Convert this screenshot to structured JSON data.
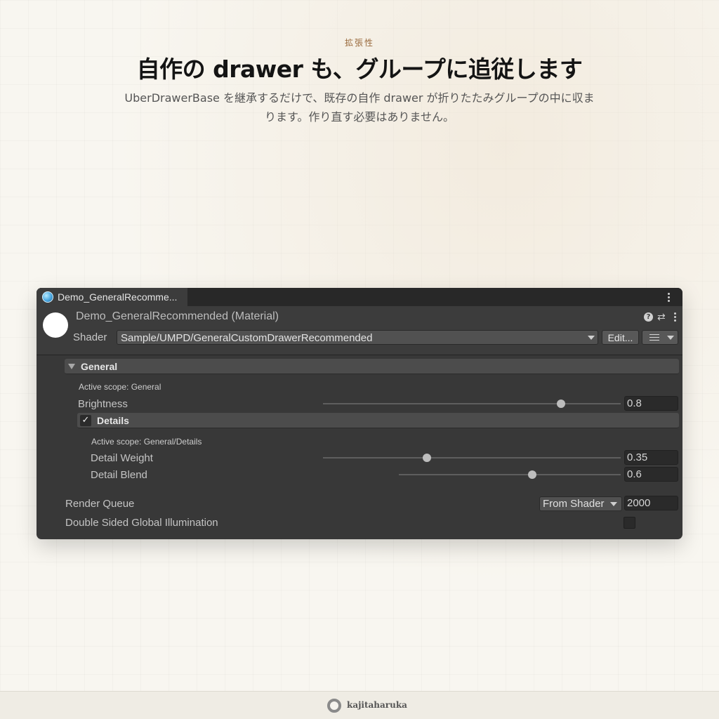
{
  "page": {
    "eyebrow": "拡張性",
    "headline": "自作の drawer も、グループに追従します",
    "subtext": "UberDrawerBase を継承するだけで、既存の自作 drawer が折りたたみグループの中に収まります。作り直す必要はありません。"
  },
  "inspector": {
    "tab_label": "Demo_GeneralRecomme...",
    "material_title": "Demo_GeneralRecommended (Material)",
    "shader_label": "Shader",
    "shader_value": "Sample/UMPD/GeneralCustomDrawerRecommended",
    "edit_label": "Edit...",
    "help_glyph": "?",
    "preset_glyph": "⇄",
    "groups": {
      "general": {
        "label": "General",
        "scope": "Active scope: General",
        "brightness_label": "Brightness",
        "brightness_value": "0.8",
        "brightness_fraction": 0.8
      },
      "details": {
        "label": "Details",
        "checked": true,
        "check_glyph": "✓",
        "scope": "Active scope: General/Details",
        "detail_weight_label": "Detail Weight",
        "detail_weight_value": "0.35",
        "detail_weight_fraction": 0.35,
        "detail_blend_label": "Detail Blend",
        "detail_blend_value": "0.6",
        "detail_blend_fraction": 0.6
      }
    },
    "render_queue_label": "Render Queue",
    "render_queue_mode": "From Shader",
    "render_queue_value": "2000",
    "double_sided_gi_label": "Double Sided Global Illumination",
    "double_sided_gi_checked": false
  },
  "footer": {
    "brand": "kajitaharuka"
  },
  "colors": {
    "eyebrow": "#9a6b3e",
    "inspector_bg": "#383838",
    "accent_icon": "#4aa7e0"
  }
}
